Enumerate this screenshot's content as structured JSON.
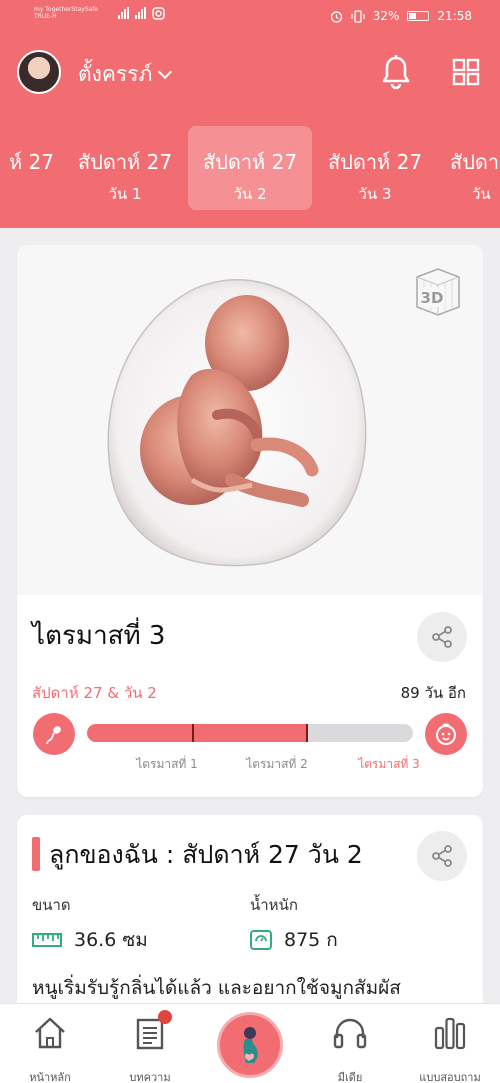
{
  "status": {
    "carrier": "my TogetherStaySafe TRUE-H",
    "battery": "32%",
    "time": "21:58"
  },
  "header": {
    "user_name": "ตั้งครรภ์"
  },
  "day_tabs": [
    {
      "week": "ห์ 27",
      "day": ""
    },
    {
      "week": "สัปดาห์ 27",
      "day": "วัน 1"
    },
    {
      "week": "สัปดาห์ 27",
      "day": "วัน 2",
      "active": true
    },
    {
      "week": "สัปดาห์ 27",
      "day": "วัน 3"
    },
    {
      "week": "สัปดา",
      "day": "วัน"
    }
  ],
  "trimester_card": {
    "badge": "3D",
    "title": "ไตรมาสที่ 3",
    "week_day": "สัปดาห์ 27 & วัน 2",
    "days_left": "89 วัน อีก",
    "progress_fraction": 0.675,
    "labels": [
      "ไตรมาสที่ 1",
      "ไตรมาสที่ 2",
      "ไตรมาสที่ 3"
    ]
  },
  "baby_card": {
    "title": "ลูกของฉัน : สัปดาห์ 27 วัน 2",
    "size_label": "ขนาด",
    "size_value": "36.6 ซม",
    "weight_label": "น้ำหนัก",
    "weight_value": "875 ก",
    "description": "หนูเริ่มรับรู้กลิ่นได้แล้ว และอยากใช้จมูกสัมผัส"
  },
  "bottom_nav": {
    "home": "หน้าหลัก",
    "articles": "บทความ",
    "media": "มีเดีย",
    "survey": "แบบสอบถาม"
  },
  "colors": {
    "primary": "#f26d72",
    "background": "#eeeef1"
  }
}
